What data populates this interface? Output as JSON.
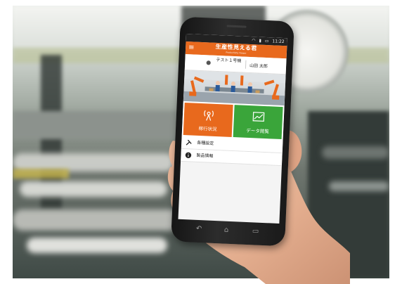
{
  "photo": {
    "description_icons": [
      "pressure-gauge-icon",
      "hand-icon"
    ]
  },
  "phone": {
    "status_time": "11:22",
    "status_icons": [
      "wifi-icon",
      "signal-icon",
      "battery-icon"
    ],
    "app_title": "生産性見える君",
    "app_subtitle": "Productivity Viewer",
    "menu_icon": "hamburger-icon",
    "machine_name": "テスト１号機",
    "user_name": "山田 太郎",
    "tiles": [
      {
        "label": "稼行状況",
        "icon": "radio-tower-icon",
        "color": "#e8691d"
      },
      {
        "label": "データ閲覧",
        "icon": "chart-icon",
        "color": "#3aa53a"
      }
    ],
    "list": [
      {
        "label": "各種設定",
        "icon": "tools-icon"
      },
      {
        "label": "製品情報",
        "icon": "info-icon"
      }
    ],
    "nav": [
      "back-icon",
      "home-icon",
      "recent-apps-icon"
    ]
  }
}
